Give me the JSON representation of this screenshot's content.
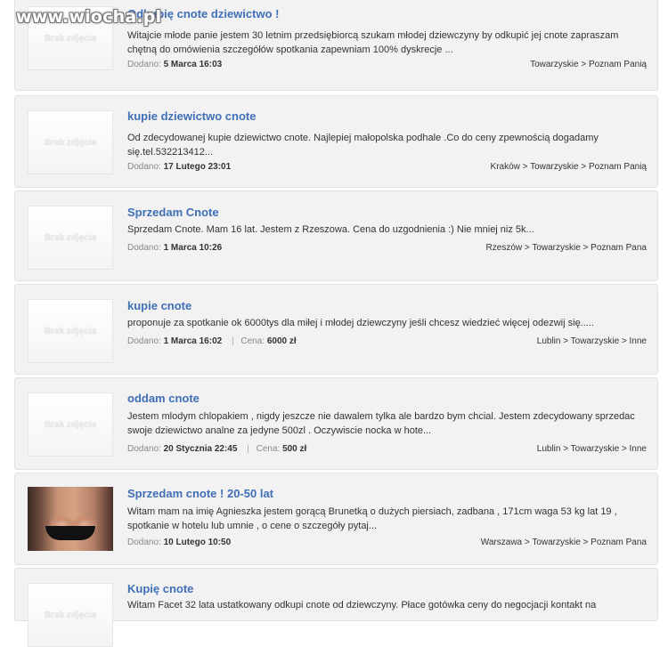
{
  "watermark": "www.wiocha.pl",
  "labels": {
    "added": "Dodano:",
    "price": "Cena:",
    "no_photo": "Brak zdjęcia"
  },
  "items": [
    {
      "title": "Odkupię cnote dziewictwo !",
      "desc": "Witajcie młode panie jestem 30 letnim przedsiębiorcą szukam młodej dziewczyny by odkupić jej cnote zapraszam chętną do omówienia szczegółów spotkania zapewniam 100% dyskrecje ...",
      "date": "5 Marca 16:03",
      "location": "Towarzyskie > Poznam Panią",
      "price": ""
    },
    {
      "title": "kupie dziewictwo cnote",
      "desc": "Od zdecydowanej kupie dziewictwo cnote. Najlepiej małopolska podhale .Co do ceny zpewnością dogadamy się.tel.532213412...",
      "date": "17 Lutego 23:01",
      "location": "Kraków > Towarzyskie > Poznam Panią",
      "price": ""
    },
    {
      "title": "Sprzedam Cnote",
      "desc": "Sprzedam Cnote. Mam 16 lat. Jestem z Rzeszowa. Cena do uzgodnienia :) Nie mniej niz 5k...",
      "date": "1 Marca 10:26",
      "location": "Rzeszów > Towarzyskie > Poznam Pana",
      "price": ""
    },
    {
      "title": "kupie cnote",
      "desc": "proponuje za spotkanie ok 6000tys dla miłej i młodej dziewczyny jeśli chcesz wiedzieć więcej odezwij się.....",
      "date": "1 Marca 16:02",
      "location": "Lublin > Towarzyskie > Inne",
      "price": "6000 zł"
    },
    {
      "title": "oddam cnote",
      "desc": "Jestem mlodym chlopakiem , nigdy jeszcze nie dawalem tylka ale bardzo bym chcial. Jestem zdecydowany sprzedac swoje dziewictwo analne za jedyne 500zl . Oczywiscie nocka w hote...",
      "date": "20 Stycznia 22:45",
      "location": "Lublin > Towarzyskie > Inne",
      "price": "500 zł"
    },
    {
      "title": "Sprzedam cnote ! 20-50 lat",
      "desc": "Witam mam na imię Agnieszka jestem gorącą Brunetką o dużych piersiach, zadbana , 171cm waga 53 kg lat 19 , spotkanie w hotelu lub umnie , o cene o szczegóły pytaj...",
      "date": "10 Lutego 10:50",
      "location": "Warszawa > Towarzyskie > Poznam Pana",
      "price": ""
    },
    {
      "title": "Kupię cnote",
      "desc": "Witam Facet 32 lata ustatkowany odkupi cnote od dziewczyny. Płace gotówka ceny do negocjacji kontakt na",
      "date": "",
      "location": "",
      "price": ""
    }
  ]
}
